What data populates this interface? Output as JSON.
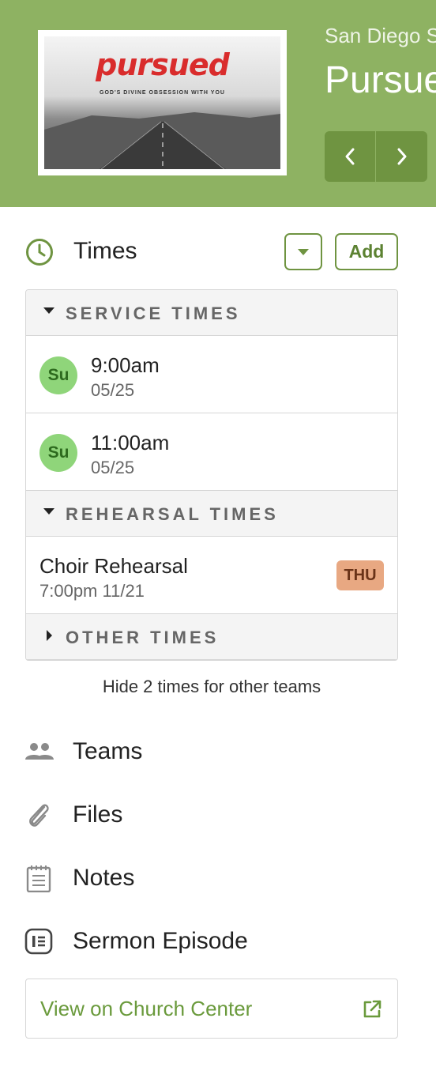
{
  "header": {
    "artwork": {
      "title": "pursued",
      "subtitle": "GOD'S DIVINE OBSESSION WITH YOU"
    },
    "subtitle": "San Diego S",
    "title": "Pursue",
    "prev_icon": "chevron-left-icon",
    "next_icon": "chevron-right-icon",
    "background_color": "#8eb262",
    "nav_color": "#6f9441"
  },
  "times": {
    "label": "Times",
    "icon": "clock-icon",
    "dropdown_icon": "caret-down-icon",
    "add_label": "Add",
    "sections": [
      {
        "label": "SERVICE TIMES",
        "expanded": true,
        "items": [
          {
            "day": "Su",
            "time": "9:00am",
            "date": "05/25"
          },
          {
            "day": "Su",
            "time": "11:00am",
            "date": "05/25"
          }
        ]
      },
      {
        "label": "REHEARSAL TIMES",
        "expanded": true,
        "items": [
          {
            "name": "Choir Rehearsal",
            "time": "7:00pm 11/21",
            "badge": "THU"
          }
        ]
      },
      {
        "label": "OTHER TIMES",
        "expanded": false,
        "items": []
      }
    ],
    "hide_link": "Hide 2 times for other teams"
  },
  "sidebar": {
    "items": [
      {
        "label": "Teams",
        "icon": "people-icon"
      },
      {
        "label": "Files",
        "icon": "paperclip-icon"
      },
      {
        "label": "Notes",
        "icon": "notepad-icon"
      },
      {
        "label": "Sermon Episode",
        "icon": "episode-icon"
      }
    ]
  },
  "church_center": {
    "label": "View on Church Center",
    "icon": "external-link-icon"
  },
  "colors": {
    "accent": "#6f9441",
    "day_avatar": "#8fd57a",
    "badge_thu": "#e8a882",
    "link": "#6a9a3c"
  }
}
